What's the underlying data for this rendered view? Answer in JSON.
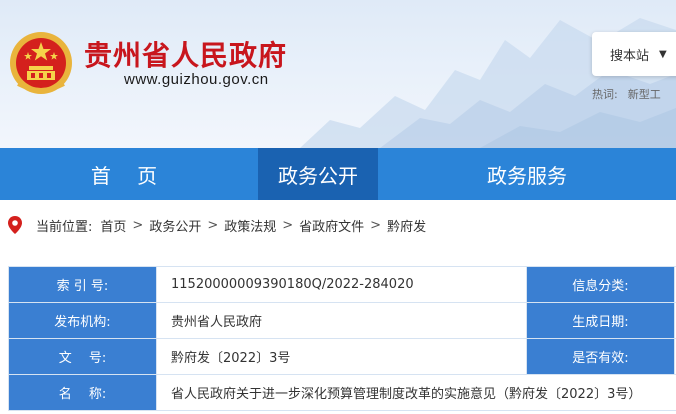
{
  "header": {
    "site_title": "贵州省人民政府",
    "site_url": "www.guizhou.gov.cn",
    "search_label": "搜本站",
    "hot_label": "热词:",
    "hot_words": [
      "新型工"
    ]
  },
  "nav": {
    "items": [
      {
        "label": "首 页"
      },
      {
        "label": "政务公开"
      },
      {
        "label": "政务服务"
      }
    ]
  },
  "breadcrumb": {
    "prefix": "当前位置:",
    "items": [
      "首页",
      "政务公开",
      "政策法规",
      "省政府文件",
      "黔府发"
    ],
    "separator": ">"
  },
  "info_table": {
    "rows": [
      {
        "label": "索 引 号:",
        "value": "11520000009390180Q/2022-284020",
        "label2": "信息分类:"
      },
      {
        "label": "发布机构:",
        "value": "贵州省人民政府",
        "label2": "生成日期:"
      },
      {
        "label": "文　 号:",
        "value": "黔府发〔2022〕3号",
        "label2": "是否有效:"
      },
      {
        "label": "名　 称:",
        "value": "省人民政府关于进一步深化预算管理制度改革的实施意见（黔府发〔2022〕3号）",
        "label2": ""
      }
    ]
  },
  "colors": {
    "nav_bg": "#2b84d8",
    "nav_active": "#1a62b1",
    "label_bg": "#3a7fd2",
    "title_red": "#c8161d"
  }
}
